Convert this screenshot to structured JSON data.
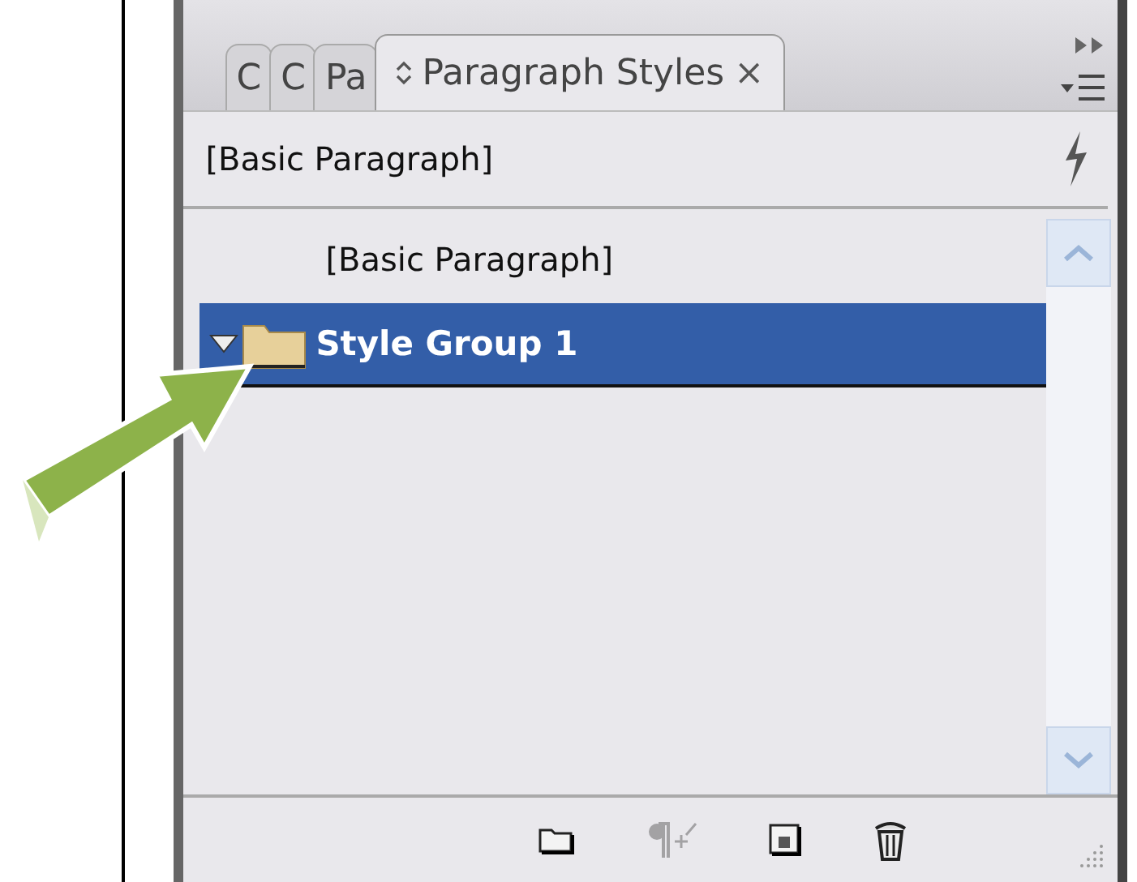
{
  "panel": {
    "tabs": [
      {
        "label": "C",
        "selected": false
      },
      {
        "label": "C",
        "selected": false
      },
      {
        "label": "Pa",
        "selected": false
      },
      {
        "label": "Paragraph Styles",
        "selected": true,
        "close": "×"
      }
    ],
    "current_style": "[Basic Paragraph]",
    "items": [
      {
        "kind": "style",
        "label": "[Basic Paragraph]",
        "selected": false
      },
      {
        "kind": "group",
        "label": "Style Group 1",
        "expanded": true,
        "selected": true
      }
    ],
    "footer_buttons": [
      {
        "kind": "folder",
        "disabled": false
      },
      {
        "kind": "paragraph-plus",
        "disabled": true
      },
      {
        "kind": "new",
        "disabled": false
      },
      {
        "kind": "trash",
        "disabled": false
      }
    ]
  }
}
